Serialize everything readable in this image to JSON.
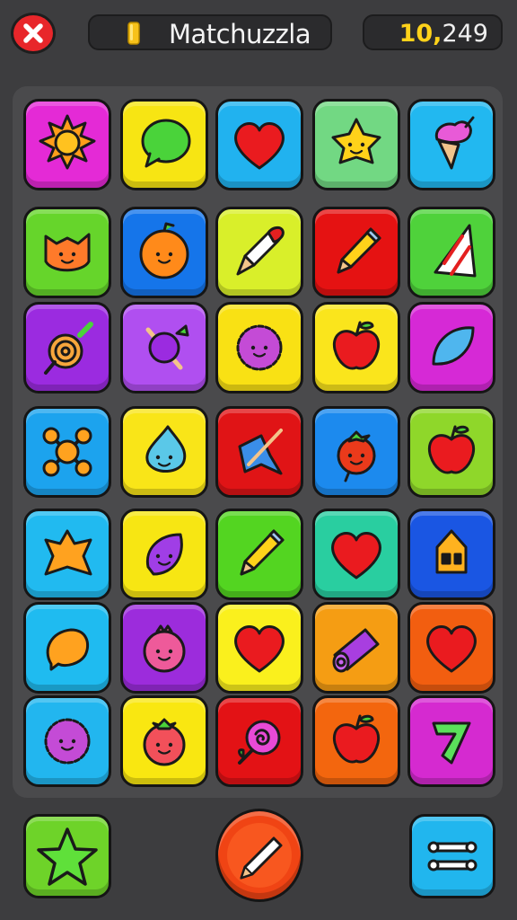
{
  "header": {
    "title": "Matchuzzla",
    "score_main": "10,",
    "score_tail": "249",
    "close_icon": "close-x-icon",
    "coin_icon": "coin-icon"
  },
  "colors": {
    "background": "#3d3d3f",
    "board": "#4a4a4c",
    "score_accent": "#ffd21a",
    "close": "#e8262a"
  },
  "board": {
    "rows": 7,
    "cols": 5,
    "tiles": [
      {
        "color": "#e42ad6",
        "icon": "sun"
      },
      {
        "color": "#f7e513",
        "icon": "speech-bubble"
      },
      {
        "color": "#21b2ef",
        "icon": "heart"
      },
      {
        "color": "#72d883",
        "icon": "star-face"
      },
      {
        "color": "#22b8f0",
        "icon": "ice-cream"
      },
      {
        "color": "#66d52b",
        "icon": "cat"
      },
      {
        "color": "#1575ea",
        "icon": "orange-face"
      },
      {
        "color": "#d9ef2a",
        "icon": "rocket"
      },
      {
        "color": "#e51212",
        "icon": "pencil"
      },
      {
        "color": "#4fd23b",
        "icon": "party-hat"
      },
      {
        "color": "#9b2be0",
        "icon": "lollipop"
      },
      {
        "color": "#b04ff0",
        "icon": "plum"
      },
      {
        "color": "#f9e114",
        "icon": "fuzzy-ball"
      },
      {
        "color": "#fae51c",
        "icon": "apple"
      },
      {
        "color": "#d629d6",
        "icon": "leaf"
      },
      {
        "color": "#1ca3ee",
        "icon": "molecule"
      },
      {
        "color": "#f9e518",
        "icon": "water-drop"
      },
      {
        "color": "#e01416",
        "icon": "arrow-burst"
      },
      {
        "color": "#1c8aee",
        "icon": "tomato"
      },
      {
        "color": "#8fd72a",
        "icon": "apple"
      },
      {
        "color": "#21baf0",
        "icon": "star-blob"
      },
      {
        "color": "#f7e613",
        "icon": "purple-leaf"
      },
      {
        "color": "#53d521",
        "icon": "pencil"
      },
      {
        "color": "#29cea0",
        "icon": "heart"
      },
      {
        "color": "#1a56e3",
        "icon": "house"
      },
      {
        "color": "#1fbbf0",
        "icon": "lemon"
      },
      {
        "color": "#9c2cdc",
        "icon": "pomegranate"
      },
      {
        "color": "#faf01d",
        "icon": "heart"
      },
      {
        "color": "#f59d13",
        "icon": "candy-roll"
      },
      {
        "color": "#f25e10",
        "icon": "heart"
      },
      {
        "color": "#22b6ef",
        "icon": "fuzzy-ball"
      },
      {
        "color": "#f9e711",
        "icon": "tomato-face"
      },
      {
        "color": "#e31215",
        "icon": "rose"
      },
      {
        "color": "#f3660e",
        "icon": "apple"
      },
      {
        "color": "#d52ad0",
        "icon": "zigzag"
      }
    ]
  },
  "footer": {
    "left_icon": "star-icon",
    "center_icon": "pencil-icon",
    "right_icon": "menu-lines-icon"
  }
}
